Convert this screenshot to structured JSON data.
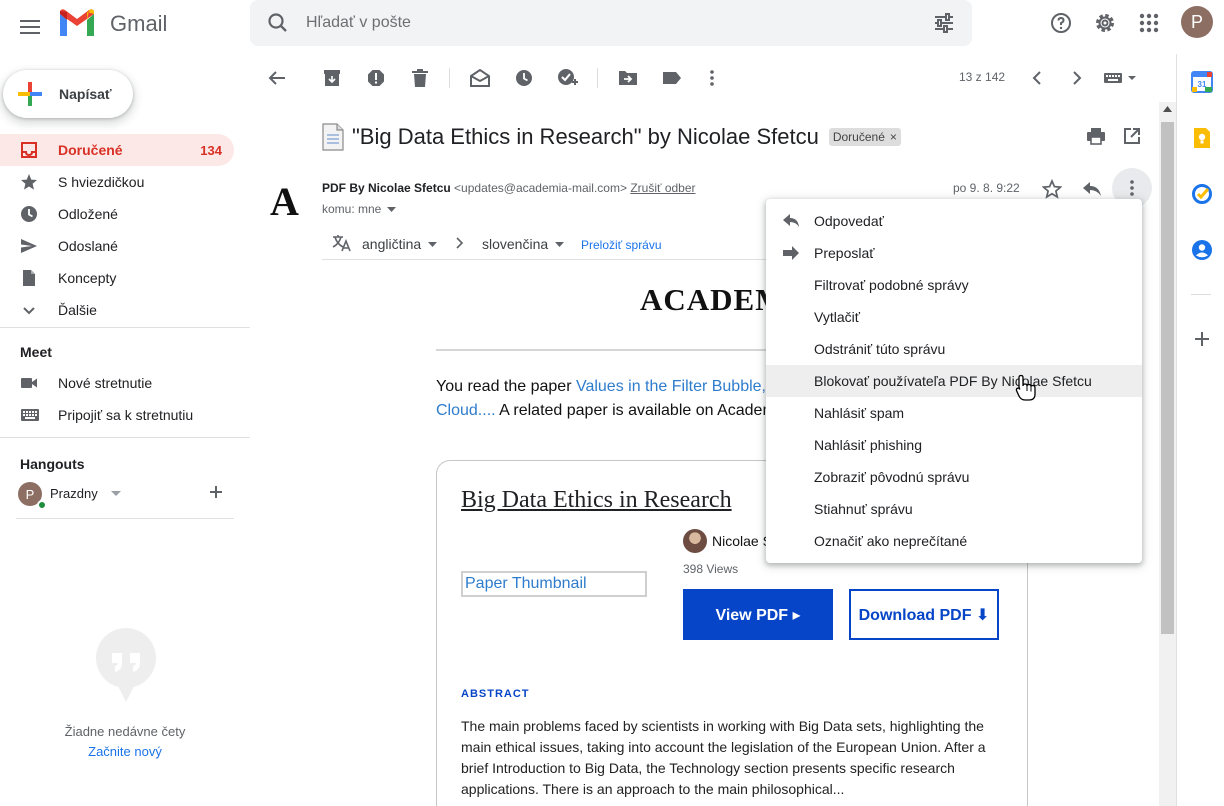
{
  "app": {
    "name": "Gmail"
  },
  "search": {
    "placeholder": "Hľadať v pošte"
  },
  "colors": {
    "accent": "#d93025",
    "link": "#1a73e8",
    "academia_blue": "#0645c7",
    "avatar": "#8d6e63"
  },
  "sidebar": {
    "compose_label": "Napísať",
    "items": [
      {
        "label": "Doručené",
        "count": "134",
        "icon": "inbox-icon",
        "active": true
      },
      {
        "label": "S hviezdičkou",
        "icon": "star-icon"
      },
      {
        "label": "Odložené",
        "icon": "clock-icon"
      },
      {
        "label": "Odoslané",
        "icon": "send-icon"
      },
      {
        "label": "Koncepty",
        "icon": "draft-icon"
      },
      {
        "label": "Ďalšie",
        "icon": "chevron-down-icon"
      }
    ],
    "meet": {
      "title": "Meet",
      "items": [
        {
          "label": "Nové stretnutie",
          "icon": "video-icon"
        },
        {
          "label": "Pripojiť sa k stretnutiu",
          "icon": "keyboard-icon"
        }
      ]
    },
    "hangouts": {
      "title": "Hangouts",
      "user": "Prazdny",
      "user_initial": "P",
      "empty_text": "Žiadne nedávne čety",
      "start_link": "Začnite nový"
    }
  },
  "user": {
    "initial": "P"
  },
  "toolbar": {
    "pager": "13 z 142"
  },
  "message": {
    "subject": "\"Big Data Ethics in Research\" by Nicolae Sfetcu",
    "label_chip": "Doručené",
    "label_chip_close": "×",
    "sender_logo": "A",
    "sender_name": "PDF By Nicolae Sfetcu",
    "sender_email": "<updates@academia-mail.com>",
    "unsubscribe": "Zrušiť odber",
    "to": "komu: mne",
    "date": "po 9. 8. 9:22"
  },
  "translate": {
    "from": "angličtina",
    "to": "slovenčina",
    "link": "Preložiť správu"
  },
  "email_body": {
    "logo": "ACADEMIA",
    "intro_prefix": "You read the paper ",
    "intro_link": "Values in the Filter Bubble, Ethics of Big Data Environments in Cloud....",
    "intro_suffix": " A related paper is available on Academia.edu.",
    "card": {
      "title": "Big Data Ethics in Research",
      "author": "Nicolae Sfetcu",
      "views": "398 Views",
      "thumbnail_alt": "Paper Thumbnail",
      "view_pdf": "View PDF ▸",
      "download_pdf": "Download PDF ⬇",
      "abstract_heading": "ABSTRACT",
      "abstract_text": "The main problems faced by scientists in working with Big Data sets, highlighting the main ethical issues, taking into account the legislation of the European Union. After a brief Introduction to Big Data, the Technology section presents specific research applications. There is an approach to the main philosophical..."
    }
  },
  "menu": {
    "items": [
      {
        "label": "Odpovedať",
        "icon": "reply-icon"
      },
      {
        "label": "Preposlať",
        "icon": "forward-icon"
      },
      {
        "label": "Filtrovať podobné správy"
      },
      {
        "label": "Vytlačiť"
      },
      {
        "label": "Odstrániť túto správu"
      },
      {
        "label": "Blokovať používateľa PDF By Nicolae Sfetcu",
        "hovered": true
      },
      {
        "label": "Nahlásiť spam"
      },
      {
        "label": "Nahlásiť phishing"
      },
      {
        "label": "Zobraziť pôvodnú správu"
      },
      {
        "label": "Stiahnuť správu"
      },
      {
        "label": "Označiť ako neprečítané"
      }
    ]
  }
}
